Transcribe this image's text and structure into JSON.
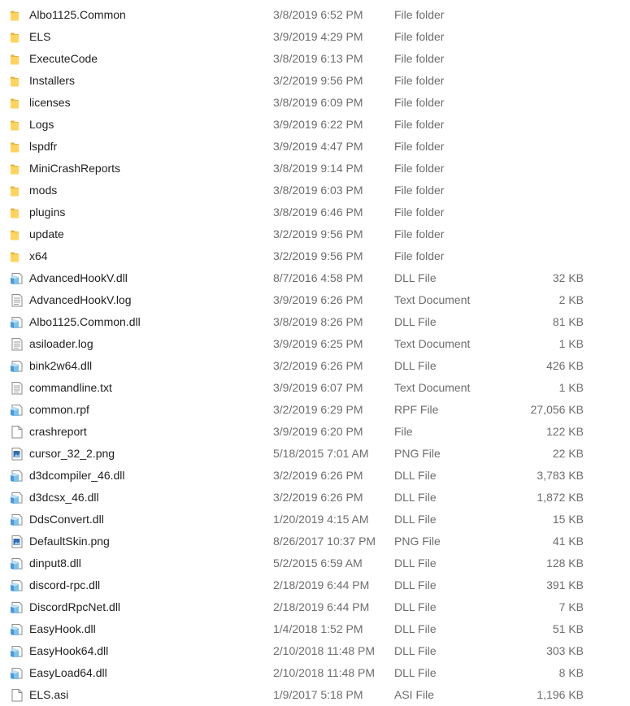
{
  "files": [
    {
      "name": "Albo1125.Common",
      "date": "3/8/2019 6:52 PM",
      "type": "File folder",
      "size": "",
      "icon": "folder-icon"
    },
    {
      "name": "ELS",
      "date": "3/9/2019 4:29 PM",
      "type": "File folder",
      "size": "",
      "icon": "folder-icon"
    },
    {
      "name": "ExecuteCode",
      "date": "3/8/2019 6:13 PM",
      "type": "File folder",
      "size": "",
      "icon": "folder-icon"
    },
    {
      "name": "Installers",
      "date": "3/2/2019 9:56 PM",
      "type": "File folder",
      "size": "",
      "icon": "folder-icon"
    },
    {
      "name": "licenses",
      "date": "3/8/2019 6:09 PM",
      "type": "File folder",
      "size": "",
      "icon": "folder-icon"
    },
    {
      "name": "Logs",
      "date": "3/9/2019 6:22 PM",
      "type": "File folder",
      "size": "",
      "icon": "folder-icon"
    },
    {
      "name": "lspdfr",
      "date": "3/9/2019 4:47 PM",
      "type": "File folder",
      "size": "",
      "icon": "folder-icon"
    },
    {
      "name": "MiniCrashReports",
      "date": "3/8/2019 9:14 PM",
      "type": "File folder",
      "size": "",
      "icon": "folder-icon"
    },
    {
      "name": "mods",
      "date": "3/8/2019 6:03 PM",
      "type": "File folder",
      "size": "",
      "icon": "folder-icon"
    },
    {
      "name": "plugins",
      "date": "3/8/2019 6:46 PM",
      "type": "File folder",
      "size": "",
      "icon": "folder-icon"
    },
    {
      "name": "update",
      "date": "3/2/2019 9:56 PM",
      "type": "File folder",
      "size": "",
      "icon": "folder-icon"
    },
    {
      "name": "x64",
      "date": "3/2/2019 9:56 PM",
      "type": "File folder",
      "size": "",
      "icon": "folder-icon"
    },
    {
      "name": "AdvancedHookV.dll",
      "date": "8/7/2016 4:58 PM",
      "type": "DLL File",
      "size": "32 KB",
      "icon": "dll-icon"
    },
    {
      "name": "AdvancedHookV.log",
      "date": "3/9/2019 6:26 PM",
      "type": "Text Document",
      "size": "2 KB",
      "icon": "text-document-icon"
    },
    {
      "name": "Albo1125.Common.dll",
      "date": "3/8/2019 8:26 PM",
      "type": "DLL File",
      "size": "81 KB",
      "icon": "dll-icon"
    },
    {
      "name": "asiloader.log",
      "date": "3/9/2019 6:25 PM",
      "type": "Text Document",
      "size": "1 KB",
      "icon": "text-document-icon"
    },
    {
      "name": "bink2w64.dll",
      "date": "3/2/2019 6:26 PM",
      "type": "DLL File",
      "size": "426 KB",
      "icon": "dll-icon"
    },
    {
      "name": "commandline.txt",
      "date": "3/9/2019 6:07 PM",
      "type": "Text Document",
      "size": "1 KB",
      "icon": "text-document-icon"
    },
    {
      "name": "common.rpf",
      "date": "3/2/2019 6:29 PM",
      "type": "RPF File",
      "size": "27,056 KB",
      "icon": "dll-icon"
    },
    {
      "name": "crashreport",
      "date": "3/9/2019 6:20 PM",
      "type": "File",
      "size": "122 KB",
      "icon": "blank-file-icon"
    },
    {
      "name": "cursor_32_2.png",
      "date": "5/18/2015 7:01 AM",
      "type": "PNG File",
      "size": "22 KB",
      "icon": "image-file-icon"
    },
    {
      "name": "d3dcompiler_46.dll",
      "date": "3/2/2019 6:26 PM",
      "type": "DLL File",
      "size": "3,783 KB",
      "icon": "dll-icon"
    },
    {
      "name": "d3dcsx_46.dll",
      "date": "3/2/2019 6:26 PM",
      "type": "DLL File",
      "size": "1,872 KB",
      "icon": "dll-icon"
    },
    {
      "name": "DdsConvert.dll",
      "date": "1/20/2019 4:15 AM",
      "type": "DLL File",
      "size": "15 KB",
      "icon": "dll-icon"
    },
    {
      "name": "DefaultSkin.png",
      "date": "8/26/2017 10:37 PM",
      "type": "PNG File",
      "size": "41 KB",
      "icon": "image-file-icon"
    },
    {
      "name": "dinput8.dll",
      "date": "5/2/2015 6:59 AM",
      "type": "DLL File",
      "size": "128 KB",
      "icon": "dll-icon"
    },
    {
      "name": "discord-rpc.dll",
      "date": "2/18/2019 6:44 PM",
      "type": "DLL File",
      "size": "391 KB",
      "icon": "dll-icon"
    },
    {
      "name": "DiscordRpcNet.dll",
      "date": "2/18/2019 6:44 PM",
      "type": "DLL File",
      "size": "7 KB",
      "icon": "dll-icon"
    },
    {
      "name": "EasyHook.dll",
      "date": "1/4/2018 1:52 PM",
      "type": "DLL File",
      "size": "51 KB",
      "icon": "dll-icon"
    },
    {
      "name": "EasyHook64.dll",
      "date": "2/10/2018 11:48 PM",
      "type": "DLL File",
      "size": "303 KB",
      "icon": "dll-icon"
    },
    {
      "name": "EasyLoad64.dll",
      "date": "2/10/2018 11:48 PM",
      "type": "DLL File",
      "size": "8 KB",
      "icon": "dll-icon"
    },
    {
      "name": "ELS.asi",
      "date": "1/9/2017 5:18 PM",
      "type": "ASI File",
      "size": "1,196 KB",
      "icon": "blank-file-icon"
    }
  ]
}
